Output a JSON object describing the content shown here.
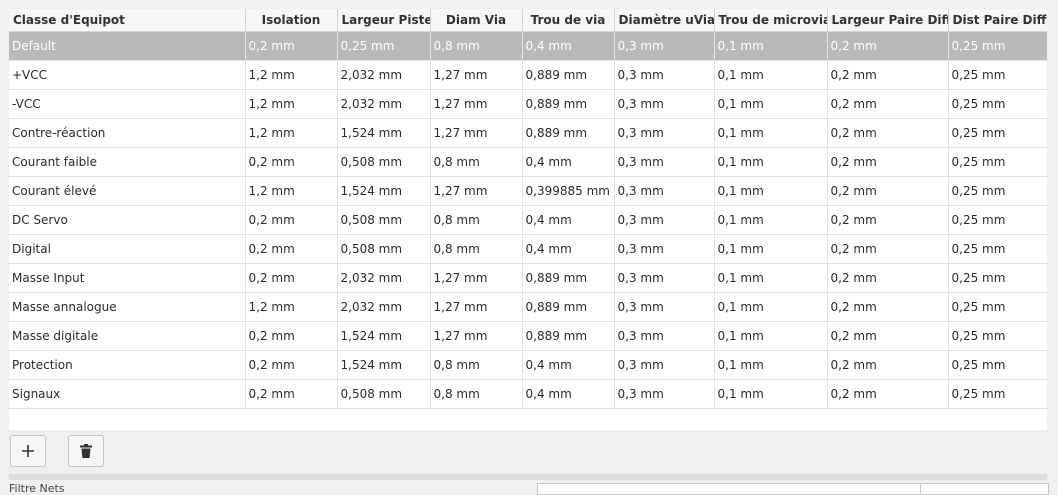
{
  "columns": [
    "Classe d'Equipot",
    "Isolation",
    "Largeur Piste",
    "Diam Via",
    "Trou de via",
    "Diamètre uVia",
    "Trou de microvia",
    "Largeur Paire Diff",
    "Dist Paire Diff"
  ],
  "rows": [
    [
      "Default",
      "0,2 mm",
      "0,25 mm",
      "0,8 mm",
      "0,4 mm",
      "0,3 mm",
      "0,1 mm",
      "0,2 mm",
      "0,25 mm"
    ],
    [
      "+VCC",
      "1,2 mm",
      "2,032 mm",
      "1,27 mm",
      "0,889 mm",
      "0,3 mm",
      "0,1 mm",
      "0,2 mm",
      "0,25 mm"
    ],
    [
      "-VCC",
      "1,2 mm",
      "2,032 mm",
      "1,27 mm",
      "0,889 mm",
      "0,3 mm",
      "0,1 mm",
      "0,2 mm",
      "0,25 mm"
    ],
    [
      "Contre-réaction",
      "1,2 mm",
      "1,524 mm",
      "1,27 mm",
      "0,889 mm",
      "0,3 mm",
      "0,1 mm",
      "0,2 mm",
      "0,25 mm"
    ],
    [
      "Courant faible",
      "0,2 mm",
      "0,508 mm",
      "0,8 mm",
      "0,4 mm",
      "0,3 mm",
      "0,1 mm",
      "0,2 mm",
      "0,25 mm"
    ],
    [
      "Courant élevé",
      "1,2 mm",
      "1,524 mm",
      "1,27 mm",
      "0,399885 mm",
      "0,3 mm",
      "0,1 mm",
      "0,2 mm",
      "0,25 mm"
    ],
    [
      "DC Servo",
      "0,2 mm",
      "0,508 mm",
      "0,8 mm",
      "0,4 mm",
      "0,3 mm",
      "0,1 mm",
      "0,2 mm",
      "0,25 mm"
    ],
    [
      "Digital",
      "0,2 mm",
      "0,508 mm",
      "0,8 mm",
      "0,4 mm",
      "0,3 mm",
      "0,1 mm",
      "0,2 mm",
      "0,25 mm"
    ],
    [
      "Masse Input",
      "0,2 mm",
      "2,032 mm",
      "1,27 mm",
      "0,889 mm",
      "0,3 mm",
      "0,1 mm",
      "0,2 mm",
      "0,25 mm"
    ],
    [
      "Masse annalogue",
      "1,2 mm",
      "2,032 mm",
      "1,27 mm",
      "0,889 mm",
      "0,3 mm",
      "0,1 mm",
      "0,2 mm",
      "0,25 mm"
    ],
    [
      "Masse digitale",
      "0,2 mm",
      "1,524 mm",
      "1,27 mm",
      "0,889 mm",
      "0,3 mm",
      "0,1 mm",
      "0,2 mm",
      "0,25 mm"
    ],
    [
      "Protection",
      "0,2 mm",
      "1,524 mm",
      "0,8 mm",
      "0,4 mm",
      "0,3 mm",
      "0,1 mm",
      "0,2 mm",
      "0,25 mm"
    ],
    [
      "Signaux",
      "0,2 mm",
      "0,508 mm",
      "0,8 mm",
      "0,4 mm",
      "0,3 mm",
      "0,1 mm",
      "0,2 mm",
      "0,25 mm"
    ]
  ],
  "selected_row": 0,
  "toolbar": {
    "add_icon": "plus-icon",
    "delete_icon": "trash-icon"
  },
  "footer": {
    "partial_label": "Filtre   Nets"
  },
  "colors": {
    "selected_row_bg": "#b9b9b9",
    "selected_row_text": "#ffffff"
  }
}
